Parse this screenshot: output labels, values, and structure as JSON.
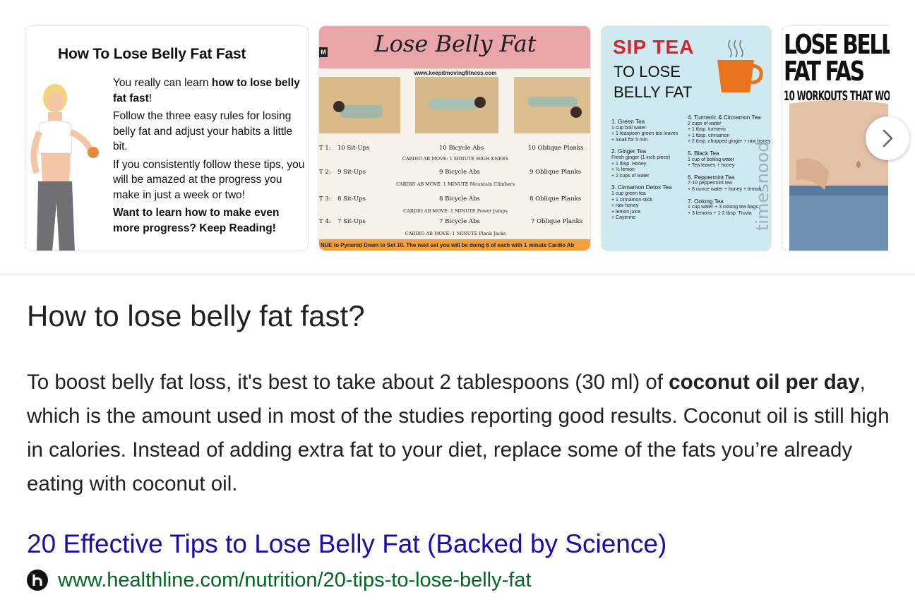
{
  "thumbnails": {
    "t1": {
      "title": "How To Lose Belly Fat Fast",
      "p1_pre": "You really can learn ",
      "p1_bold": "how to lose belly fat fast",
      "p1_post": "!",
      "p2": "Follow the three easy rules for losing belly fat and adjust your habits a little bit.",
      "p3": "If you consistently follow these tips, you will be amazed at the progress you make in just a week or two!",
      "p4": "Want to learn how to make even more progress?  Keep Reading!"
    },
    "t2": {
      "title": "Lose Belly Fat",
      "logo": "M",
      "url": "www.keepitmovingfitness.com",
      "rows": [
        {
          "set": "T 1:",
          "a": "10 Sit-Ups",
          "b": "10 Bicycle Abs",
          "c": "10 Oblique Planks",
          "cardio": "CARDIO AB MOVE: 1 MINUTE  HIGH KNEES"
        },
        {
          "set": "T 2:",
          "a": "9 Sit-Ups",
          "b": "9 Bicycle Abs",
          "c": "9 Oblique Planks",
          "cardio": "CARDIO AB MOVE: 1 MINUTE  Mountain Climbers"
        },
        {
          "set": "T 3:",
          "a": "8 Sit-Ups",
          "b": "8 Bicycle Abs",
          "c": "8 Oblique Planks",
          "cardio": "CARDIO AB MOVE: 1 MINUTE  Power Jumps"
        },
        {
          "set": "T 4:",
          "a": "7 Sit-Ups",
          "b": "7 Bicycle Abs",
          "c": "7 Oblique Planks",
          "cardio": "CARDIO AB MOVE: 1 MINUTE  Plank Jacks"
        }
      ],
      "footer": "NUE to Pyramid Down to Set 10. The next set you will be doing 6 of each with 1 minute Cardio Ab"
    },
    "t3": {
      "sip": "SIP TEA",
      "lose": "TO LOSE",
      "belly": "BELLY FAT",
      "brand": "timesnood",
      "left_col": [
        {
          "h": "1. Green Tea",
          "lines": [
            "1 cup boil water",
            "+ 1 teaspoon green tea leaves",
            "+ Soak for 5 min."
          ]
        },
        {
          "h": "2. Ginger Tea",
          "lines": [
            "Fresh ginger (1 inch piece)",
            "+ 1 tbsp. Honey",
            "+ ½ lemon",
            "+ 2 cups of water"
          ]
        },
        {
          "h": "3. Cinnamon Detox Tea",
          "lines": [
            "1 cup green tea",
            "+ 1 cinnamon stick",
            "+ raw honey",
            "+ lemon juice",
            "+ Cayenne"
          ]
        }
      ],
      "right_col": [
        {
          "h": "4. Turmeric & Cinnamon Tea",
          "lines": [
            "2 cups of water",
            "+ 1 tbsp. turmeric",
            "+ 1 tbsp. cinnamon",
            "+ 2 tbsp. chopped ginger + raw honey"
          ]
        },
        {
          "h": "5. Black Tea",
          "lines": [
            "1 cup of boiling water",
            "+ Tea leaves + honey"
          ]
        },
        {
          "h": "6. Peppermint Tea",
          "lines": [
            "7-10 peppermint tea",
            "+ 8 ounce water + honey + lemon"
          ]
        },
        {
          "h": "7. Oolong Tea",
          "lines": [
            "1 cup water + 3 oolong tea bags",
            "+ 3 lemons + 1-2 tbsp. Truvia"
          ]
        }
      ]
    },
    "t4": {
      "line1": "LOSE BELL",
      "line2": "FAT FAS",
      "line3": "10 WORKOUTS THAT WO"
    }
  },
  "carousel": {
    "next_icon": "chevron-right-icon"
  },
  "answer": {
    "question": "How to lose belly fat fast?",
    "text_1": "To boost belly fat loss, it's best to take about 2 tablespoons (30 ml) of ",
    "text_bold": "coconut oil per day",
    "text_2": ", which is the amount used in most of the studies reporting good results. Coconut oil is still high in calories. Instead of adding extra fat to your diet, replace some of the fats you’re already eating with coconut oil."
  },
  "result": {
    "title": "20 Effective Tips to Lose Belly Fat (Backed by Science)",
    "favicon_letter": "h",
    "url": "www.healthline.com/nutrition/20-tips-to-lose-belly-fat"
  },
  "colors": {
    "link": "#1a0dab",
    "url": "#006621",
    "text": "#202124",
    "t2_header": "#e8a4a9",
    "t2_footer": "#f3a13a",
    "t3_bg": "#cfe9f1",
    "t3_red": "#d7232b",
    "t3_cup": "#e8731c"
  }
}
